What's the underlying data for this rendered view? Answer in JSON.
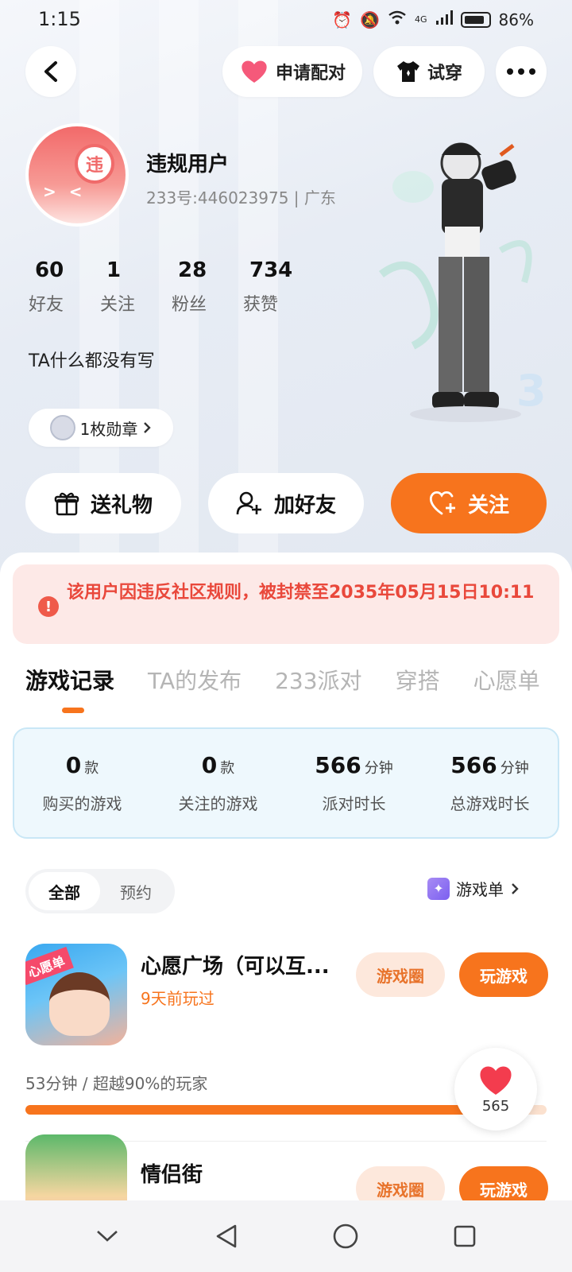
{
  "status_bar": {
    "time": "1:15",
    "battery": "86%",
    "network": "4G"
  },
  "header": {
    "pair_label": "申请配对",
    "try_label": "试穿"
  },
  "profile": {
    "avatar_badge": "违",
    "name": "违规用户",
    "id_line": "233号:446023975 | 广东",
    "stats": [
      {
        "value": "60",
        "label": "好友"
      },
      {
        "value": "1",
        "label": "关注"
      },
      {
        "value": "28",
        "label": "粉丝"
      },
      {
        "value": "734",
        "label": "获赞"
      }
    ],
    "bio": "TA什么都没有写",
    "medal": "1枚勋章"
  },
  "actions": {
    "gift": "送礼物",
    "add_friend": "加好友",
    "follow": "关注"
  },
  "ban_notice": "该用户因违反社区规则，被封禁至2035年05月15日10:11",
  "tabs": [
    "游戏记录",
    "TA的发布",
    "233派对",
    "穿搭",
    "心愿单"
  ],
  "summary": [
    {
      "value": "0",
      "unit": "款",
      "label": "购买的游戏"
    },
    {
      "value": "0",
      "unit": "款",
      "label": "关注的游戏"
    },
    {
      "value": "566",
      "unit": "分钟",
      "label": "派对时长"
    },
    {
      "value": "566",
      "unit": "分钟",
      "label": "总游戏时长"
    }
  ],
  "filters": {
    "all": "全部",
    "reserve": "预约",
    "game_list": "游戏单"
  },
  "games": [
    {
      "title": "心愿广场（可以互...",
      "last_played": "9天前玩过",
      "icon_tag": "心愿单",
      "circle_label": "游戏圈",
      "play_label": "玩游戏",
      "playtime": "53分钟 / 超越90%的玩家",
      "progress": 0.9
    },
    {
      "title": "情侣街",
      "circle_label": "游戏圈",
      "play_label": "玩游戏"
    }
  ],
  "like": {
    "count": "565"
  },
  "colors": {
    "accent": "#f7741d",
    "ban_red": "#e9483b",
    "like_red": "#f33c4e"
  }
}
